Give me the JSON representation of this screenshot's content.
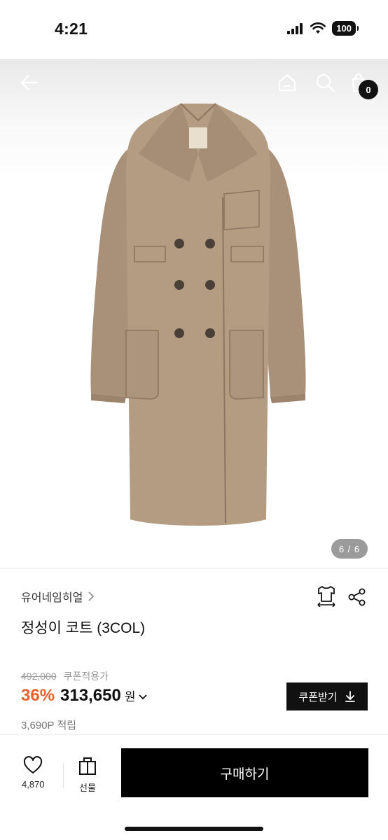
{
  "status_bar": {
    "time": "4:21",
    "battery": "100"
  },
  "gallery": {
    "page_indicator": "6 / 6",
    "cart_count": "0"
  },
  "product": {
    "brand": "유어네임히얼",
    "title": "정성이 코트 (3COL)",
    "original_price": "492,000",
    "coupon_price_label": "쿠폰적용가",
    "discount": "36%",
    "price": "313,650",
    "currency": "원",
    "points": "3,690P 적립"
  },
  "coupon_button": {
    "label": "쿠폰받기"
  },
  "bottom_bar": {
    "like_count": "4,870",
    "gift_label": "선물",
    "buy_label": "구매하기"
  },
  "colors": {
    "discount": "#e8622c",
    "primary": "#000000",
    "coat": "#b49c83"
  },
  "icons": [
    "back-arrow-icon",
    "home-icon",
    "search-icon",
    "cart-icon",
    "size-guide-icon",
    "share-icon",
    "heart-icon",
    "gift-icon",
    "download-icon",
    "chevron-right-icon",
    "chevron-down-icon"
  ]
}
